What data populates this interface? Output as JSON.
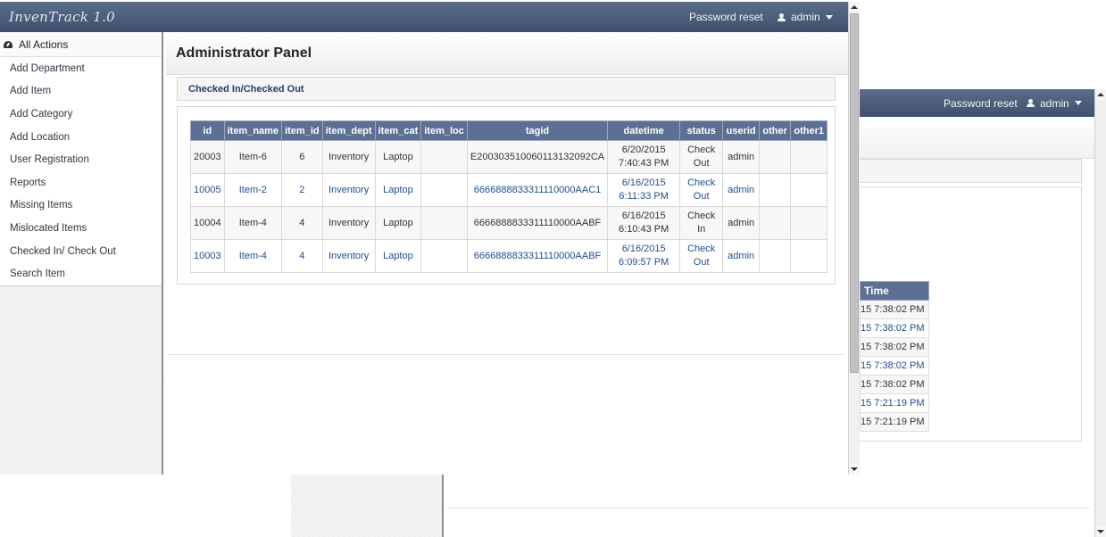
{
  "app": {
    "brand": "InvenTrack 1.0",
    "nav_password_reset": "Password reset",
    "nav_user": "admin"
  },
  "sidebar": {
    "header": "All Actions",
    "items": [
      {
        "label": "Add Department"
      },
      {
        "label": "Add Item"
      },
      {
        "label": "Add Category"
      },
      {
        "label": "Add Location"
      },
      {
        "label": "User Registration"
      },
      {
        "label": "Reports"
      },
      {
        "label": "Missing Items"
      },
      {
        "label": "Mislocated Items"
      },
      {
        "label": "Checked In/ Check Out"
      },
      {
        "label": "Search Item"
      }
    ]
  },
  "main": {
    "title": "Administrator Panel",
    "panel_title": "Checked In/Checked Out",
    "table": {
      "columns": [
        "id",
        "item_name",
        "item_id",
        "item_dept",
        "item_cat",
        "item_loc",
        "tagid",
        "datetime",
        "status",
        "userid",
        "other",
        "other1"
      ],
      "rows": [
        {
          "id": "20003",
          "item_name": "Item-6",
          "item_id": "6",
          "item_dept": "Inventory",
          "item_cat": "Laptop",
          "item_loc": "",
          "tagid": "E20030351006011313209 2CA",
          "tagid_full": "E200303510060113132092CA",
          "date": "6/20/2015",
          "time": "7:40:43 PM",
          "status_1": "Check",
          "status_2": "Out",
          "userid": "admin",
          "other": "",
          "other1": ""
        },
        {
          "id": "10005",
          "item_name": "Item-2",
          "item_id": "2",
          "item_dept": "Inventory",
          "item_cat": "Laptop",
          "item_loc": "",
          "tagid_full": "6666888833311110000AAC1",
          "date": "6/16/2015",
          "time": "6:11:33 PM",
          "status_1": "Check",
          "status_2": "Out",
          "userid": "admin",
          "other": "",
          "other1": ""
        },
        {
          "id": "10004",
          "item_name": "Item-4",
          "item_id": "4",
          "item_dept": "Inventory",
          "item_cat": "Laptop",
          "item_loc": "",
          "tagid_full": "6666888833311110000AABF",
          "date": "6/16/2015",
          "time": "6:10:43 PM",
          "status_1": "Check",
          "status_2": "In",
          "userid": "admin",
          "other": "",
          "other1": ""
        },
        {
          "id": "10003",
          "item_name": "Item-4",
          "item_id": "4",
          "item_dept": "Inventory",
          "item_cat": "Laptop",
          "item_loc": "",
          "tagid_full": "6666888833311110000AABF",
          "date": "6/16/2015",
          "time": "6:09:57 PM",
          "status_1": "Check",
          "status_2": "Out",
          "userid": "admin",
          "other": "",
          "other1": ""
        }
      ]
    }
  },
  "back_window": {
    "nav_password_reset": "Password reset",
    "nav_user": "admin",
    "table_header": "Time",
    "rows": [
      "15 7:38:02 PM",
      "15 7:38:02 PM",
      "15 7:38:02 PM",
      "15 7:38:02 PM",
      "15 7:38:02 PM",
      "15 7:21:19 PM",
      "15 7:21:19 PM"
    ]
  },
  "colors": {
    "navbar": "#4d5d7a",
    "table_header": "#5d7093",
    "link": "#1f4e8c"
  }
}
